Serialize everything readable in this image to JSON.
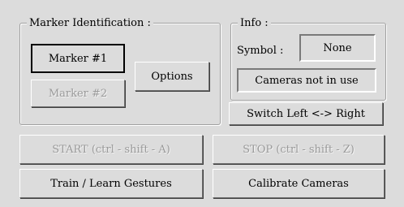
{
  "marker_identification": {
    "title": "Marker Identification :",
    "marker1_label": "Marker #1",
    "marker2_label": "Marker #2",
    "options_label": "Options"
  },
  "info": {
    "title": "Info :",
    "symbol_label": "Symbol :",
    "symbol_value": "None",
    "camera_status": "Cameras not in use"
  },
  "actions": {
    "switch_label": "Switch Left <-> Right",
    "start_label": "START  (ctrl - shift - A)",
    "stop_label": "STOP  (ctrl - shift - Z)",
    "train_label": "Train / Learn Gestures",
    "calibrate_label": "Calibrate Cameras"
  }
}
